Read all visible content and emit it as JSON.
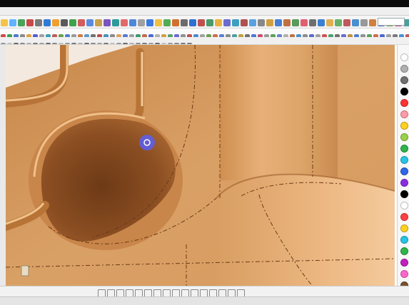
{
  "window": {
    "title": "",
    "right_label": ""
  },
  "menu": {
    "items": []
  },
  "toolbar": {
    "row1_buttons": [
      "#f2c44b",
      "#61b2ff",
      "#4aa35b",
      "#c94a4a",
      "#7a7a7a",
      "#2e7bd6",
      "#f0a030",
      "#5b5b5b",
      "#3fa34b",
      "#d35b5b",
      "#5a8be0",
      "#c9a14b",
      "#7a55c0",
      "#2e9a9a",
      "#e06a6a",
      "#4f87d8",
      "#a0a0a0",
      "#3c7be0",
      "#f0c040",
      "#55aa55",
      "#d07030",
      "#6c6c6c",
      "#2f6fd0",
      "#c05050",
      "#4a9a6a",
      "#e8b040",
      "#6a6ad0",
      "#3da0c0",
      "#b05050",
      "#5aa0e0",
      "#888888",
      "#d0a040",
      "#4a7fd0",
      "#c07040",
      "#5a9a5a",
      "#e06070",
      "#6f6f6f",
      "#3a80d0",
      "#e0b050",
      "#6ab06a",
      "#c05a5a",
      "#4a90d0",
      "#999999",
      "#d08040",
      "#5a6fd0",
      "#7fa04a",
      "#c04a8a",
      "#4aa0a0",
      "#e09050",
      "#707070",
      "#3b7bd0",
      "#b0b0b0"
    ],
    "row2_buttons": [
      "#6a6a6a",
      "#d04a4a",
      "#3aa050",
      "#4a7ad0",
      "#8a8a8a",
      "#e0a040",
      "#5a5ad0",
      "#a0a0a0",
      "#3aa0b0",
      "#c05a5a",
      "#6aa04a",
      "#4a80d0",
      "#9a9a9a",
      "#d07a40",
      "#5a9ad0",
      "#707070",
      "#c04a4a",
      "#4a90c0",
      "#8a8a8a",
      "#e0a060",
      "#5a7ad0",
      "#a0a0a0",
      "#3a9a6a",
      "#c06a4a",
      "#4a6ad0",
      "#b0b0b0",
      "#d0a040",
      "#5aa06a",
      "#6a6ad0",
      "#909090",
      "#c05050",
      "#4a8ad0",
      "#a0a0a0",
      "#6aa04a",
      "#d06a4a",
      "#5a80d0",
      "#8a8a8a",
      "#4aa0a0",
      "#c0a040",
      "#707070",
      "#4a7ad0",
      "#d04a6a",
      "#9a9a9a",
      "#5aa05a",
      "#6a80d0",
      "#b0b0b0",
      "#c07040",
      "#4a90d0",
      "#8a8a8a",
      "#5a6ad0",
      "#a0a0a0",
      "#d05050",
      "#4aa070",
      "#707070",
      "#6a6ad0",
      "#c09040",
      "#4a80d0",
      "#909090",
      "#5aa05a",
      "#d06a4a",
      "#4a6ad0",
      "#a0a0a0",
      "#7a7a7a",
      "#4a90d0",
      "#c05a5a",
      "#b0b0b0",
      "#5a9a5a",
      "#4a70d0",
      "#8a8a8a",
      "#e0a050",
      "#6a6a6a"
    ],
    "row3_buttons": [
      "#7a7a7a",
      "#9a9a9a",
      "#c0c0c0",
      "#6a6a6a",
      "#8a8a8a",
      "#b0b0b0",
      "#7a7a7a",
      "#a0a0a0",
      "#6a6a6a",
      "#8a8a8a",
      "#c0c0c0",
      "#9a9a9a",
      "#7a7a7a",
      "#b0b0b0",
      "#6a6a6a",
      "#8a8a8a",
      "#a0a0a0",
      "#7a7a7a",
      "#c0c0c0",
      "#9a9a9a",
      "#6a6a6a",
      "#b0b0b0",
      "#8a8a8a",
      "#7a7a7a",
      "#a0a0a0",
      "#6a6a6a",
      "#c0c0c0",
      "#9a9a9a",
      "#8a8a8a",
      "#7a7a7a"
    ]
  },
  "palette": {
    "swatches": [
      "#ffffff",
      "#b0b0b0",
      "#707070",
      "#000000",
      "#ff3333",
      "#ff9aa8",
      "#ffd21f",
      "#9ad14a",
      "#2fb34a",
      "#27c4e6",
      "#2f66e6",
      "#8a2be2",
      "#000000",
      "#ffffff",
      "#ff4040",
      "#ffd21f",
      "#27c4e6",
      "#2fb34a",
      "#c020c0",
      "#ff66cc",
      "#7a5230"
    ]
  },
  "bottom_toolbar": {
    "tools": [
      "rect",
      "fill",
      "line-icon",
      "slash-icon",
      "arc-icon",
      "circle-icon",
      "square-icon",
      "line-icon",
      "plus-icon",
      "point-icon",
      "dash-icon",
      "arrow-icon",
      "edit-icon",
      "hatch-icon",
      "text-icon",
      "more-icon"
    ]
  },
  "status": {
    "left": "",
    "middle": "",
    "right": "",
    "right2": ""
  },
  "colors": {
    "model_base": "#d39a5d",
    "model_highlight": "#f0c08a",
    "model_shadow": "#8a5226",
    "cursor_circle": "#5a5ff0",
    "viewport_bg": "#f3e9de"
  }
}
